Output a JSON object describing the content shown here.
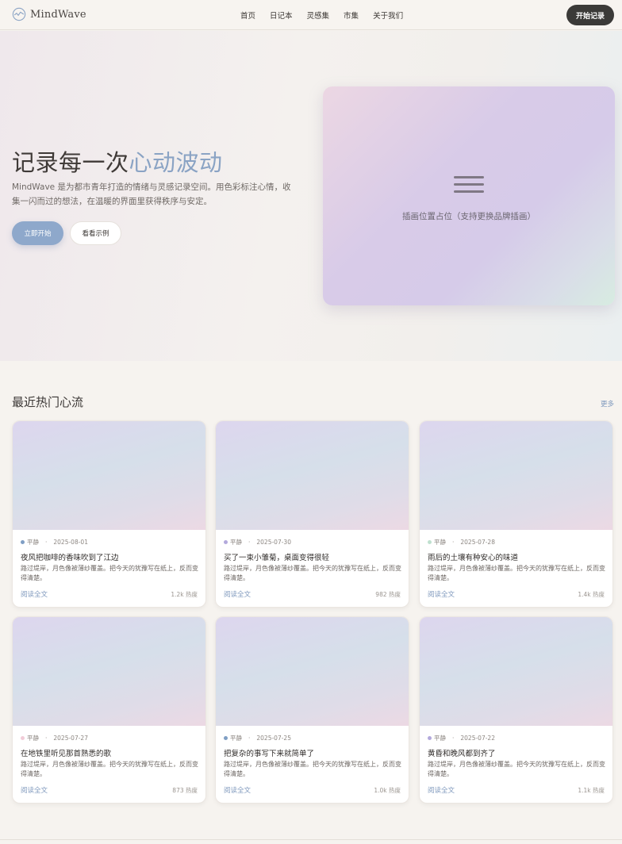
{
  "header": {
    "logo_text": "MindWave",
    "logo_icon": "wave-line-icon",
    "nav": [
      "首页",
      "日记本",
      "灵感集",
      "市集",
      "关于我们"
    ],
    "cta": "开始记录"
  },
  "hero": {
    "title_main": "记录每一次",
    "title_accent": "心动波动",
    "description": "MindWave 是为都市青年打造的情绪与灵感记录空间。用色彩标注心情，收集一闪而过的想法，在温暖的界面里获得秩序与安定。",
    "primary_button": "立即开始",
    "secondary_button": "看看示例",
    "illustration_icon": "menu-lines-icon",
    "illustration_placeholder": "插画位置占位（支持更换品牌插画）"
  },
  "section": {
    "title": "最近热门心流",
    "more": "更多"
  },
  "cards": [
    {
      "mood": "平静",
      "mood_color": "#7f9ec4",
      "date": "2025-08-01",
      "title": "夜风把咖啡的香味吹到了江边",
      "excerpt": "路过堤岸，月色像被薄纱覆盖。把今天的犹豫写在纸上，反而变得清楚。",
      "read": "阅读全文",
      "heat": "1.2k 热度"
    },
    {
      "mood": "平静",
      "mood_color": "#b3a9dc",
      "date": "2025-07-30",
      "title": "买了一束小雏菊，桌面变得很轻",
      "excerpt": "路过堤岸，月色像被薄纱覆盖。把今天的犹豫写在纸上，反而变得清楚。",
      "read": "阅读全文",
      "heat": "982 热度"
    },
    {
      "mood": "平静",
      "mood_color": "#bfe0cf",
      "date": "2025-07-28",
      "title": "雨后的土壤有种安心的味道",
      "excerpt": "路过堤岸，月色像被薄纱覆盖。把今天的犹豫写在纸上，反而变得清楚。",
      "read": "阅读全文",
      "heat": "1.4k 热度"
    },
    {
      "mood": "平静",
      "mood_color": "#f1ccd8",
      "date": "2025-07-27",
      "title": "在地铁里听见那首熟悉的歌",
      "excerpt": "路过堤岸，月色像被薄纱覆盖。把今天的犹豫写在纸上，反而变得清楚。",
      "read": "阅读全文",
      "heat": "873 热度"
    },
    {
      "mood": "平静",
      "mood_color": "#7f9ec4",
      "date": "2025-07-25",
      "title": "把复杂的事写下来就简单了",
      "excerpt": "路过堤岸，月色像被薄纱覆盖。把今天的犹豫写在纸上，反而变得清楚。",
      "read": "阅读全文",
      "heat": "1.0k 热度"
    },
    {
      "mood": "平静",
      "mood_color": "#b3a9dc",
      "date": "2025-07-22",
      "title": "黄昏和晚风都到齐了",
      "excerpt": "路过堤岸，月色像被薄纱覆盖。把今天的犹豫写在纸上，反而变得清楚。",
      "read": "阅读全文",
      "heat": "1.1k 热度"
    }
  ]
}
